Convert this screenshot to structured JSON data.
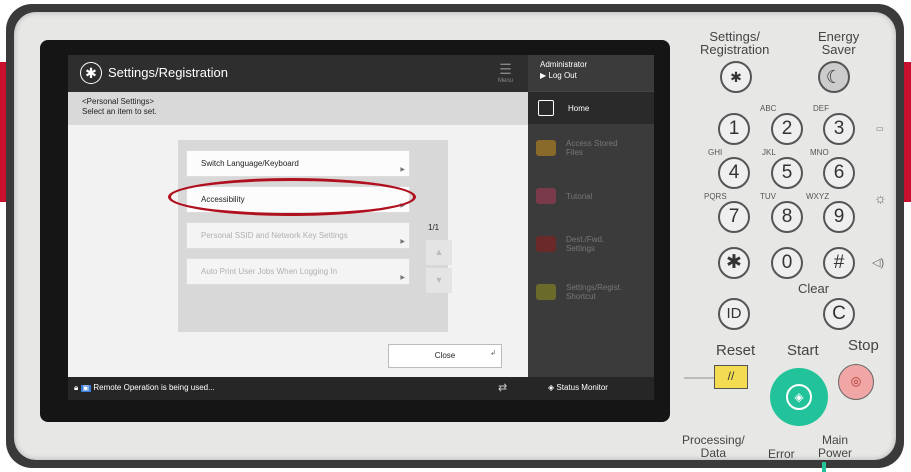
{
  "screen": {
    "title": "Settings/Registration",
    "menu_label": "Menu",
    "admin_label": "Administrator",
    "logout_label": "Log Out",
    "home_label": "Home",
    "shortcuts": [
      {
        "label": "Access Stored Files"
      },
      {
        "label": "Tutorial"
      },
      {
        "label": "Dest./Fwd. Settings"
      },
      {
        "label": "Settings/Regist. Shortcut"
      }
    ],
    "header_line1": "<Personal Settings>",
    "header_line2": "Select an item to set.",
    "items": [
      {
        "label": "Switch Language/Keyboard",
        "enabled": true
      },
      {
        "label": "Accessibility",
        "enabled": true
      },
      {
        "label": "Personal SSID and Network Key Settings",
        "enabled": false
      },
      {
        "label": "Auto Print User Jobs When Logging In",
        "enabled": false
      }
    ],
    "page_indicator": "1/1",
    "close_label": "Close",
    "status_text": "Remote Operation is being used...",
    "status_monitor_label": "Status Monitor"
  },
  "panel": {
    "settings_registration": "Settings/\nRegistration",
    "energy_saver": "Energy\nSaver",
    "keys": [
      {
        "digit": "1",
        "letters": ""
      },
      {
        "digit": "2",
        "letters": "ABC"
      },
      {
        "digit": "3",
        "letters": "DEF"
      },
      {
        "digit": "4",
        "letters": "GHI"
      },
      {
        "digit": "5",
        "letters": "JKL"
      },
      {
        "digit": "6",
        "letters": "MNO"
      },
      {
        "digit": "7",
        "letters": "PQRS"
      },
      {
        "digit": "8",
        "letters": "TUV"
      },
      {
        "digit": "9",
        "letters": "WXYZ"
      },
      {
        "digit": "✱",
        "letters": ""
      },
      {
        "digit": "0",
        "letters": ""
      },
      {
        "digit": "#",
        "letters": ""
      }
    ],
    "clear_label": "Clear",
    "clear_key": "C",
    "id_key": "ID",
    "reset_label": "Reset",
    "start_label": "Start",
    "stop_label": "Stop",
    "processing_data": "Processing/\nData",
    "error_label": "Error",
    "main_power": "Main\nPower"
  },
  "colors": {
    "accent_red": "#b00f1e",
    "start_green": "#22c39a",
    "reset_yellow": "#f4dc52"
  }
}
